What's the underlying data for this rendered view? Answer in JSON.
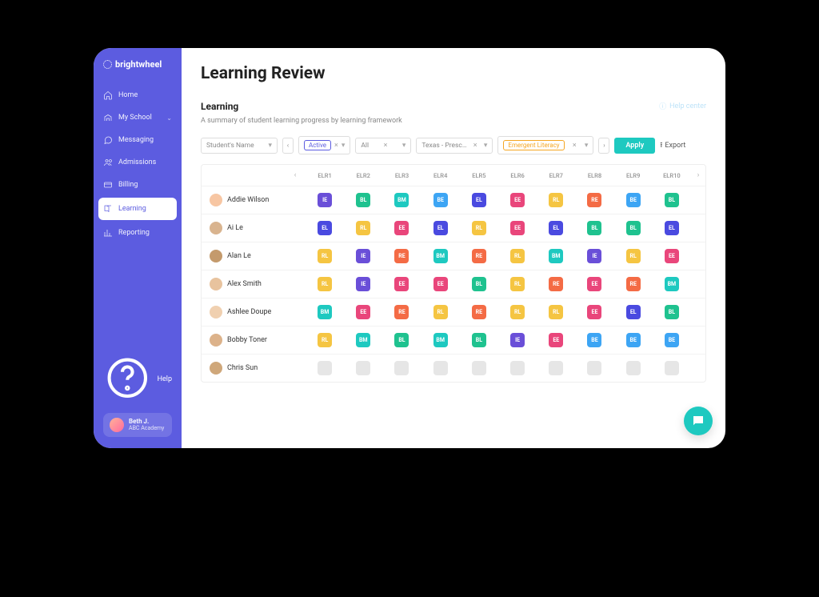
{
  "brand": "brightwheel",
  "sidebar": {
    "items": [
      {
        "label": "Home",
        "icon": "home-icon"
      },
      {
        "label": "My School",
        "icon": "school-icon",
        "expandable": true
      },
      {
        "label": "Messaging",
        "icon": "chat-icon"
      },
      {
        "label": "Admissions",
        "icon": "people-icon"
      },
      {
        "label": "Billing",
        "icon": "card-icon"
      },
      {
        "label": "Learning",
        "icon": "book-icon",
        "active": true
      },
      {
        "label": "Reporting",
        "icon": "chart-icon"
      }
    ],
    "help_label": "Help",
    "user": {
      "name": "Beth J.",
      "school": "ABC Academy"
    }
  },
  "page": {
    "title": "Learning Review",
    "section": "Learning",
    "subtitle": "A summary of student learning progress by learning framework",
    "help_center": "Help center"
  },
  "filters": {
    "student_placeholder": "Student's Name",
    "status_pill": "Active",
    "scope": "All",
    "framework": "Texas - Presc…",
    "domain_pill": "Emergent Literacy",
    "apply": "Apply",
    "export": "Export"
  },
  "table": {
    "columns": [
      "ELR1",
      "ELR2",
      "ELR3",
      "ELR4",
      "ELR5",
      "ELR6",
      "ELR7",
      "ELR8",
      "ELR9",
      "ELR10"
    ],
    "rows": [
      {
        "name": "Addie Wilson",
        "levels": [
          "IE",
          "BL",
          "BM",
          "BE",
          "EL",
          "EE",
          "RL",
          "RE",
          "BE",
          "BL"
        ]
      },
      {
        "name": "Ai Le",
        "levels": [
          "EL",
          "RL",
          "EE",
          "EL",
          "RL",
          "EE",
          "EL",
          "BL",
          "BL",
          "EL"
        ]
      },
      {
        "name": "Alan Le",
        "levels": [
          "RL",
          "IE",
          "RE",
          "BM",
          "RE",
          "RL",
          "BM",
          "IE",
          "RL",
          "EE"
        ]
      },
      {
        "name": "Alex Smith",
        "levels": [
          "RL",
          "IE",
          "EE",
          "EE",
          "BL",
          "RL",
          "RE",
          "EE",
          "RE",
          "BM"
        ]
      },
      {
        "name": "Ashlee Doupe",
        "levels": [
          "BM",
          "EE",
          "RE",
          "RL",
          "RE",
          "RL",
          "RL",
          "EE",
          "EL",
          "BL"
        ]
      },
      {
        "name": "Bobby Toner",
        "levels": [
          "RL",
          "BM",
          "BL",
          "BM",
          "BL",
          "IE",
          "EE",
          "BE",
          "BE",
          "BE"
        ]
      },
      {
        "name": "Chris Sun",
        "levels": [
          "",
          "",
          "",
          "",
          "",
          "",
          "",
          "",
          "",
          ""
        ]
      }
    ]
  },
  "level_colors": {
    "IE": "#6a4fd8",
    "BL": "#1fc28f",
    "BM": "#1ec9c0",
    "BE": "#3da5f4",
    "EL": "#4a4ae0",
    "EE": "#e9467b",
    "RL": "#f5c542",
    "RE": "#f46b45"
  }
}
